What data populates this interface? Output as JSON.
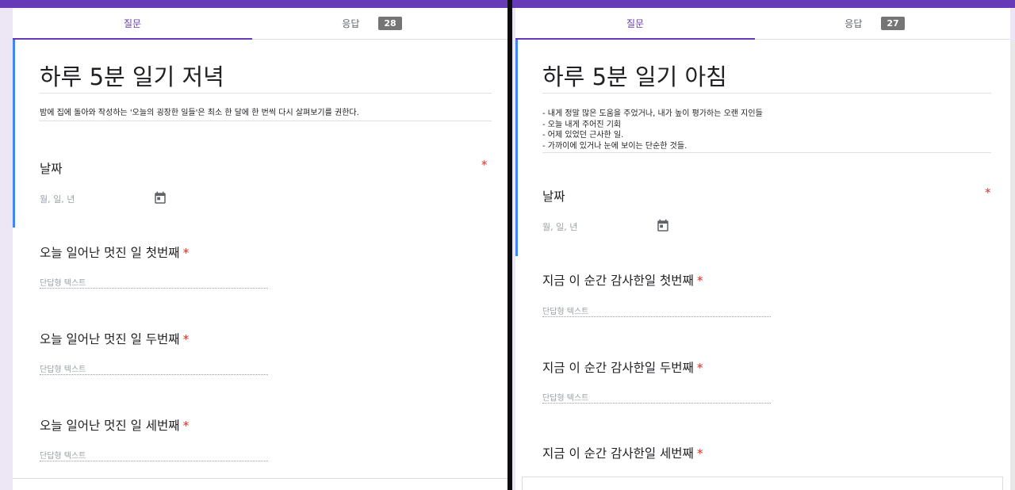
{
  "left": {
    "tabs": {
      "questions": "질문",
      "responses": "응답",
      "count": "28"
    },
    "title": "하루 5분 일기 저녁",
    "description": "밤에 집에 돌아와 작성하는 '오늘의 굉장한 일들'은 최소 한 달에 한 번씩 다시 살펴보기를 권한다.",
    "date_label": "날짜",
    "date_placeholder": "월, 일, 년",
    "questions": [
      "오늘 일어난 멋진 일 첫번째",
      "오늘 일어난 멋진 일 두번째",
      "오늘 일어난 멋진 일 세번째"
    ],
    "short_answer_placeholder": "단답형 텍스트",
    "required_mark": "*"
  },
  "right": {
    "tabs": {
      "questions": "질문",
      "responses": "응답",
      "count": "27"
    },
    "title": "하루 5분 일기 아침",
    "description_lines": [
      "- 내게 정말 많은 도움을 주었거나, 내가 높이 평가하는 오랜 지인들",
      "- 오늘 내게 주어진 기회",
      "- 어제 있었던 근사한 일.",
      "- 가까이에 있거나 눈에 보이는 단순한 것들."
    ],
    "date_label": "날짜",
    "date_placeholder": "월, 일, 년",
    "questions": [
      "지금 이 순간 감사한일 첫번째",
      "지금 이 순간 감사한일 두번째",
      "지금 이 순간 감사한일 세번째"
    ],
    "short_answer_placeholder": "단답형 텍스트",
    "required_mark": "*"
  },
  "icons": {
    "calendar": "calendar-icon"
  },
  "colors": {
    "accent": "#673ab7",
    "focus": "#4285f4",
    "required": "#d93025",
    "badge": "#757575"
  }
}
